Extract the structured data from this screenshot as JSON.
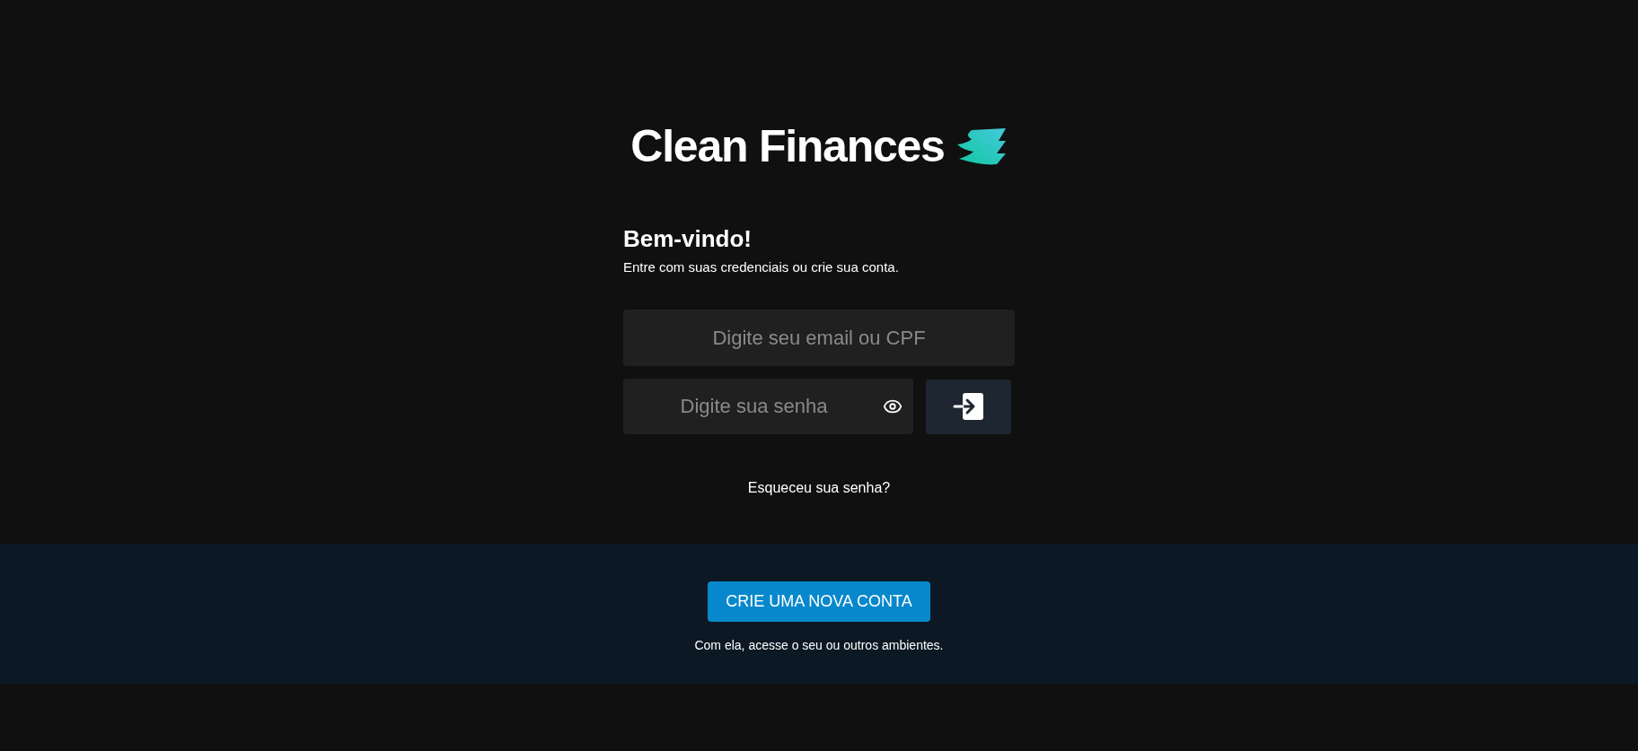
{
  "brand": {
    "title": "Clean Finances"
  },
  "welcome": {
    "heading": "Bem-vindo!",
    "subtitle": "Entre com suas credenciais ou crie sua conta."
  },
  "login_field": {
    "placeholder": "Digite seu email ou CPF"
  },
  "password_field": {
    "placeholder": "Digite sua senha"
  },
  "forgot_link": "Esqueceu sua senha?",
  "signup": {
    "button": "CRIE UMA NOVA CONTA",
    "caption": "Com ela, acesse o seu ou outros ambientes."
  }
}
